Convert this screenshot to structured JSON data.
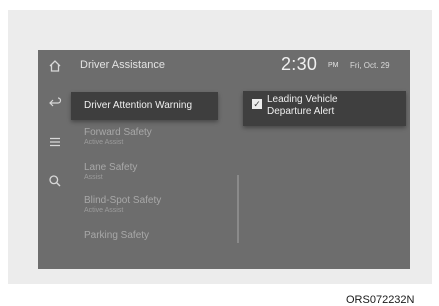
{
  "screen": {
    "title": "Driver Assistance",
    "time": "2:30",
    "ampm": "PM",
    "date": "Fri, Oct. 29"
  },
  "sidebar": {
    "icons": [
      "home-icon",
      "back-icon",
      "menu-icon",
      "search-icon"
    ]
  },
  "menu": {
    "selected_label": "Driver Attention Warning",
    "items": [
      {
        "label": "Forward Safety",
        "sub": "Active Assist"
      },
      {
        "label": "Lane Safety",
        "sub": "Assist"
      },
      {
        "label": "Blind-Spot Safety",
        "sub": "Active Assist"
      },
      {
        "label": "Parking Safety",
        "sub": ""
      }
    ]
  },
  "option": {
    "label_line1": "Leading Vehicle",
    "label_line2": "Departure Alert",
    "checked": true
  },
  "caption": "ORS072232N"
}
